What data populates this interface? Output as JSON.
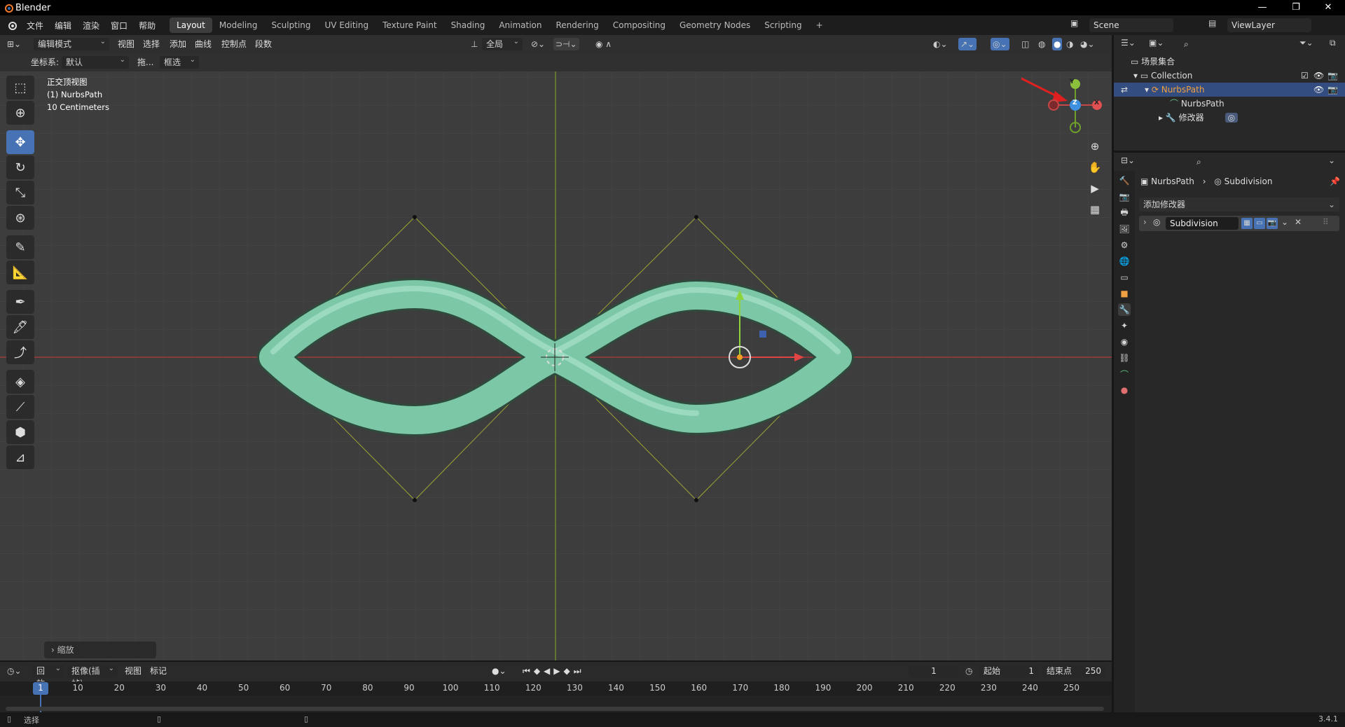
{
  "window": {
    "title": "Blender",
    "min": "—",
    "restore": "❐",
    "close": "✕"
  },
  "menus": [
    "文件",
    "编辑",
    "渲染",
    "窗口",
    "帮助"
  ],
  "workspaces": [
    {
      "label": "Layout",
      "active": true
    },
    {
      "label": "Modeling"
    },
    {
      "label": "Sculpting"
    },
    {
      "label": "UV Editing"
    },
    {
      "label": "Texture Paint"
    },
    {
      "label": "Shading"
    },
    {
      "label": "Animation"
    },
    {
      "label": "Rendering"
    },
    {
      "label": "Compositing"
    },
    {
      "label": "Geometry Nodes"
    },
    {
      "label": "Scripting"
    },
    {
      "label": "+"
    }
  ],
  "scene": {
    "name": "Scene",
    "viewlayer": "ViewLayer"
  },
  "viewport_header": {
    "mode": "编辑模式",
    "menus": [
      "视图",
      "选择",
      "添加",
      "曲线",
      "控制点",
      "段数"
    ],
    "transform_orientation": "全局"
  },
  "viewport_header2": {
    "coord_label": "坐标系:",
    "coord_value": "默认",
    "drag_label": "拖...",
    "select_mode": "框选"
  },
  "overlay": {
    "view_name": "正交顶视图",
    "object": "(1) NurbsPath",
    "scale": "10 Centimeters"
  },
  "gizmo": {
    "y": "Y",
    "z": "Z",
    "x": "X"
  },
  "last_op": {
    "label": "缩放"
  },
  "outliner": {
    "scene_collection": "场景集合",
    "collection": "Collection",
    "object": "NurbsPath",
    "data": "NurbsPath",
    "modifiers": "修改器"
  },
  "properties": {
    "breadcrumb_obj": "NurbsPath",
    "breadcrumb_mod": "Subdivision",
    "add_modifier": "添加修改器",
    "modifier_name": "Subdivision"
  },
  "timeline": {
    "playback": "回放",
    "keying": "抠像(插帧)",
    "view": "视图",
    "marker": "标记",
    "current_frame": "1",
    "start_label": "起始",
    "start": "1",
    "end_label": "结束点",
    "end": "250",
    "ruler": [
      "1",
      "10",
      "20",
      "30",
      "40",
      "50",
      "60",
      "70",
      "80",
      "90",
      "100",
      "110",
      "120",
      "130",
      "140",
      "150",
      "160",
      "170",
      "180",
      "190",
      "200",
      "210",
      "220",
      "230",
      "240",
      "250"
    ]
  },
  "status": {
    "select": "选择",
    "version": "3.4.1"
  },
  "colors": {
    "accent": "#4772b3",
    "tube": "#7bc7a6",
    "x_axis": "#c84646",
    "y_axis": "#6fa02c",
    "cage": "#9ea334"
  }
}
